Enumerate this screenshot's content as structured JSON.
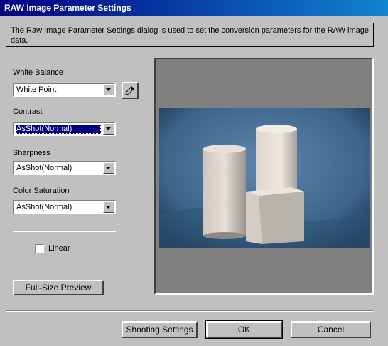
{
  "window": {
    "title": "RAW Image Parameter Settings"
  },
  "description": "The Raw Image Parameter Settings dialog is used to set the conversion parameters for the RAW image data.",
  "white_balance": {
    "label": "White Balance",
    "value": "White Point",
    "picker_icon": "eyedropper-icon"
  },
  "contrast": {
    "label": "Contrast",
    "value": "AsShot(Normal)"
  },
  "sharpness": {
    "label": "Sharpness",
    "value": "AsShot(Normal)"
  },
  "color_saturation": {
    "label": "Color Saturation",
    "value": "AsShot(Normal)"
  },
  "linear": {
    "label": "Linear",
    "checked": false
  },
  "buttons": {
    "full_size_preview": "Full-Size Preview",
    "shooting_settings": "Shooting Settings",
    "ok": "OK",
    "cancel": "Cancel"
  },
  "colors": {
    "title_bar": "#000080",
    "face": "#c0c0c0",
    "selection": "#000080",
    "preview_bg": "#808080"
  }
}
